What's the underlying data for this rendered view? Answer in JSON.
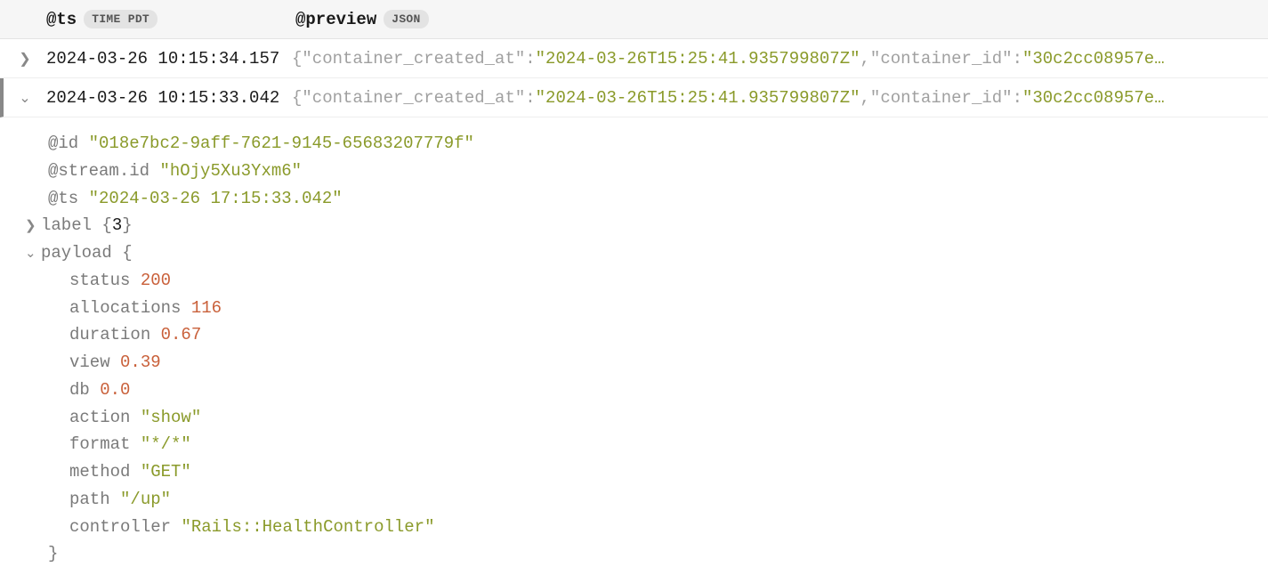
{
  "header": {
    "ts_label": "@ts",
    "ts_badge": "TIME PDT",
    "preview_label": "@preview",
    "preview_badge": "JSON"
  },
  "rows": [
    {
      "expanded": false,
      "ts": "2024-03-26 10:15:34.157",
      "preview": {
        "open": "{",
        "k1": "\"container_created_at\"",
        "c1": ":",
        "v1": "\"2024-03-26T15:25:41.935799807Z\"",
        "sep": ",",
        "k2": "\"container_id\"",
        "c2": ":",
        "v2": "\"30c2cc08957e…"
      }
    },
    {
      "expanded": true,
      "ts": "2024-03-26 10:15:33.042",
      "preview": {
        "open": "{",
        "k1": "\"container_created_at\"",
        "c1": ":",
        "v1": "\"2024-03-26T15:25:41.935799807Z\"",
        "sep": ",",
        "k2": "\"container_id\"",
        "c2": ":",
        "v2": "\"30c2cc08957e…"
      }
    }
  ],
  "detail": {
    "meta": {
      "id_key": "@id",
      "id_val": "\"018e7bc2-9aff-7621-9145-65683207779f\"",
      "stream_key": "@stream.id",
      "stream_val": "\"hOjy5Xu3Yxm6\"",
      "ts_key": "@ts",
      "ts_val": "\"2024-03-26 17:15:33.042\""
    },
    "label": {
      "key": "label",
      "open": " {",
      "count": "3",
      "close": "}"
    },
    "payload": {
      "key": "payload",
      "open": " {",
      "close": "}",
      "status_k": "status",
      "status_v": "200",
      "allocations_k": "allocations",
      "allocations_v": "116",
      "duration_k": "duration",
      "duration_v": "0.67",
      "view_k": "view",
      "view_v": "0.39",
      "db_k": "db",
      "db_v": "0.0",
      "action_k": "action",
      "action_v": "\"show\"",
      "format_k": "format",
      "format_v": "\"*/*\"",
      "method_k": "method",
      "method_v": "\"GET\"",
      "path_k": "path",
      "path_v": "\"/up\"",
      "controller_k": "controller",
      "controller_v": "\"Rails::HealthController\""
    }
  }
}
